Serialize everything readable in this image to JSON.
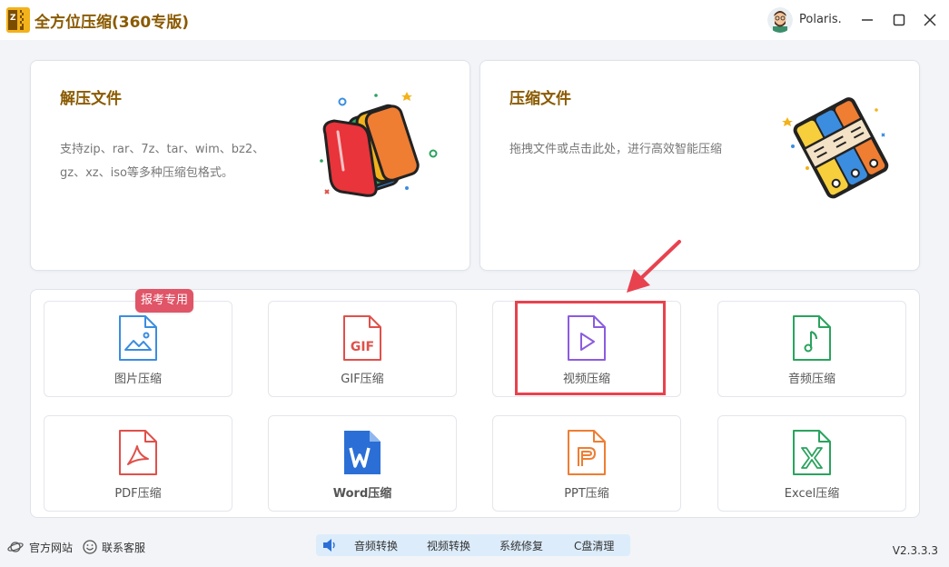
{
  "app": {
    "title": "全方位压缩(360专版)",
    "username": "Polaris."
  },
  "cards": {
    "extract": {
      "title": "解压文件",
      "desc": "支持zip、rar、7z、tar、wim、bz2、gz、xz、iso等多种压缩包格式。"
    },
    "compress": {
      "title": "压缩文件",
      "desc": "拖拽文件或点击此处，进行高效智能压缩"
    }
  },
  "badge": "报考专用",
  "tiles": [
    {
      "label": "图片压缩",
      "icon": "image-file-icon",
      "color": "#3b8de0"
    },
    {
      "label": "GIF压缩",
      "icon": "gif-file-icon",
      "color": "#e0504a"
    },
    {
      "label": "视频压缩",
      "icon": "video-file-icon",
      "color": "#8b5ce0"
    },
    {
      "label": "音频压缩",
      "icon": "audio-file-icon",
      "color": "#2aa35e"
    },
    {
      "label": "PDF压缩",
      "icon": "pdf-file-icon",
      "color": "#e0504a"
    },
    {
      "label": "Word压缩",
      "icon": "word-file-icon",
      "color": "#2b6fd6"
    },
    {
      "label": "PPT压缩",
      "icon": "ppt-file-icon",
      "color": "#ef7d32"
    },
    {
      "label": "Excel压缩",
      "icon": "excel-file-icon",
      "color": "#2aa35e"
    }
  ],
  "footer": {
    "website": "官方网站",
    "support": "联系客服",
    "tools": [
      "音频转换",
      "视频转换",
      "系统修复",
      "C盘清理"
    ],
    "version": "V2.3.3.3"
  },
  "colors": {
    "brand": "#8a5a00",
    "highlight": "#e8424f",
    "badge": "#e05567"
  }
}
